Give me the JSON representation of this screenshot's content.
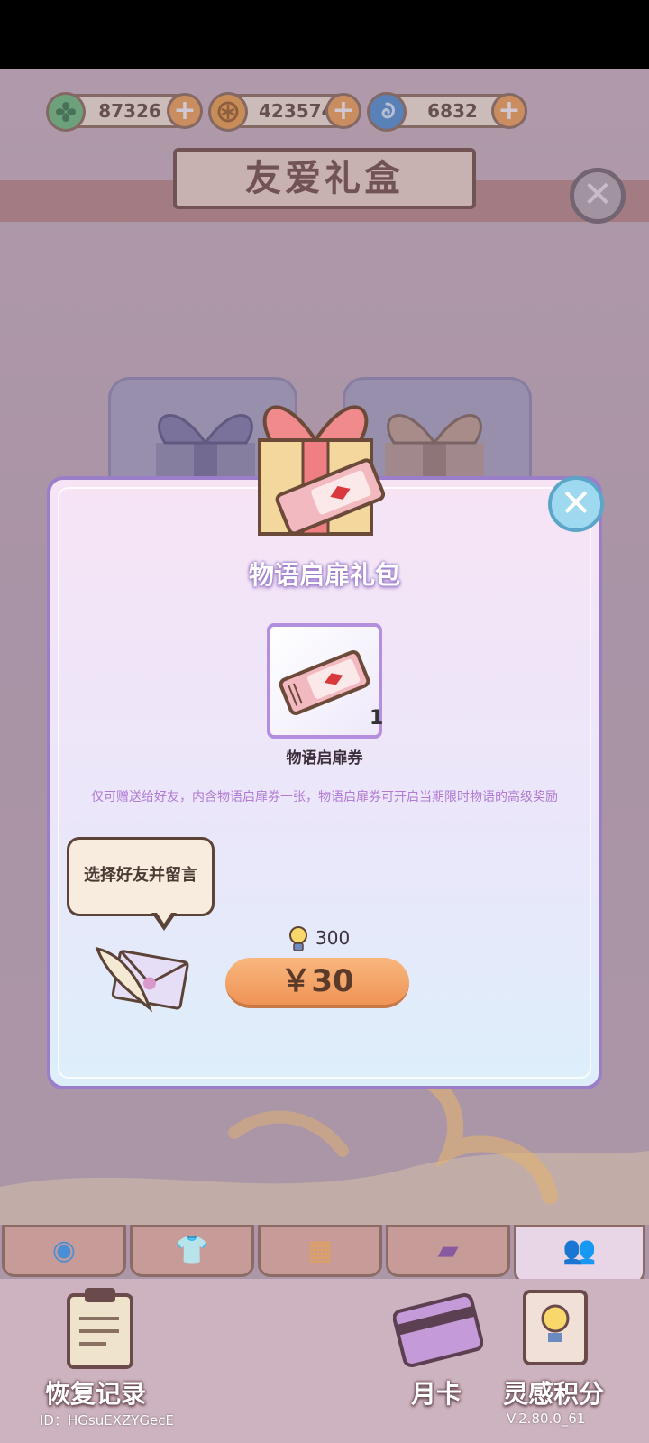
{
  "currencies": [
    {
      "name": "clover-gem",
      "value": "87326",
      "color": "#67c27a"
    },
    {
      "name": "gold-coin",
      "value": "423574",
      "color": "#f3a13f"
    },
    {
      "name": "swirl-gem",
      "value": "6832",
      "color": "#4a8fd6"
    }
  ],
  "header": {
    "title": "友爱礼盒"
  },
  "modal": {
    "pack_title": "物语启扉礼包",
    "item_name": "物语启扉券",
    "item_count": "1",
    "description": "仅可赠送给好友，内含物语启扉券一张，物语启扉券可开启当期限时物语的高级奖励",
    "bubble_text": "选择好友并留言",
    "cost_points": "300",
    "price": "￥30"
  },
  "bottom": {
    "recovery_label": "恢复记录",
    "monthly_label": "月卡",
    "points_label": "灵感积分",
    "user_id": "ID：HGsuEXZYGecE",
    "version": "V.2.80.0_61"
  },
  "colors": {
    "accent": "#9b7ec9",
    "buy_button": "#ef9457",
    "header_brown": "#6e4a3c"
  }
}
